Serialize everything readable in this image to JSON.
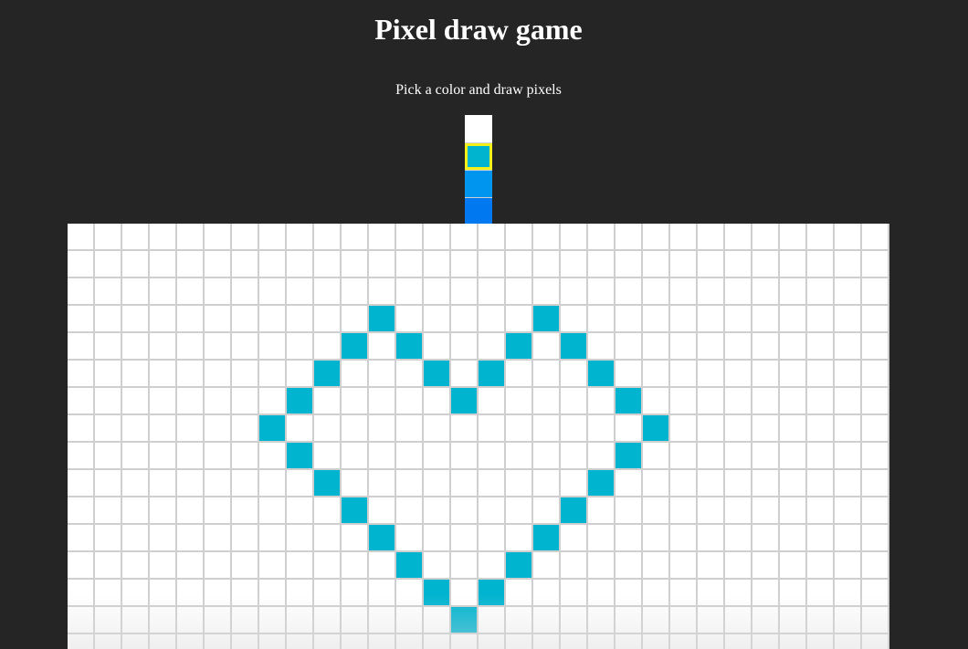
{
  "header": {
    "title": "Pixel draw game",
    "instructions": "Pick a color and draw pixels"
  },
  "palette": {
    "selected_index": 1,
    "colors": [
      {
        "name": "white",
        "hex": "#ffffff"
      },
      {
        "name": "cyan",
        "hex": "#00b4d0"
      },
      {
        "name": "sky-blue",
        "hex": "#0096f0"
      },
      {
        "name": "blue",
        "hex": "#0078f0"
      }
    ]
  },
  "canvas": {
    "columns": 30,
    "rows": 16,
    "empty_color": "#ffffff",
    "grid_line_color": "#cfcfcf",
    "painted_color": "#00b4d0",
    "painted_cells": [
      [
        3,
        11
      ],
      [
        3,
        17
      ],
      [
        4,
        10
      ],
      [
        4,
        12
      ],
      [
        4,
        16
      ],
      [
        4,
        18
      ],
      [
        5,
        9
      ],
      [
        5,
        13
      ],
      [
        5,
        15
      ],
      [
        5,
        19
      ],
      [
        6,
        8
      ],
      [
        6,
        14
      ],
      [
        6,
        20
      ],
      [
        7,
        7
      ],
      [
        7,
        21
      ],
      [
        8,
        8
      ],
      [
        8,
        20
      ],
      [
        9,
        9
      ],
      [
        9,
        19
      ],
      [
        10,
        10
      ],
      [
        10,
        18
      ],
      [
        11,
        11
      ],
      [
        11,
        17
      ],
      [
        12,
        12
      ],
      [
        12,
        16
      ],
      [
        13,
        13
      ],
      [
        13,
        15
      ],
      [
        14,
        14
      ]
    ]
  },
  "colors": {
    "background": "#252525",
    "selected_outline": "#f4f01c"
  }
}
